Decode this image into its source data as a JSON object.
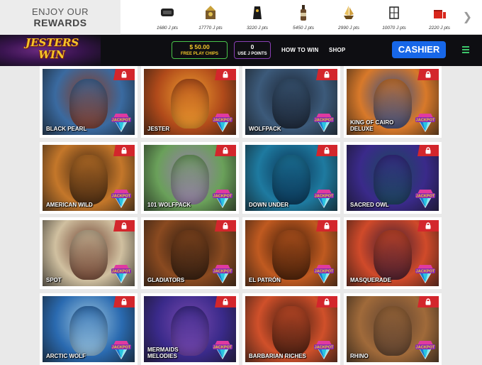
{
  "rewards": {
    "title_line1": "ENJOY OUR",
    "title_line2": "REWARDS",
    "items": [
      {
        "pts": "1680 J pts",
        "icon": "vr-headset-icon"
      },
      {
        "pts": "17770 J pts",
        "icon": "jester-treasure-icon"
      },
      {
        "pts": "3220 J pts",
        "icon": "speaker-icon"
      },
      {
        "pts": "5450 J pts",
        "icon": "bottle-icon"
      },
      {
        "pts": "2990 J pts",
        "icon": "ship-icon"
      },
      {
        "pts": "10070 J pts",
        "icon": "cube-frame-icon"
      },
      {
        "pts": "2220 J pts",
        "icon": "gift-box-icon"
      }
    ]
  },
  "nav": {
    "logo_line1": "JESTERS",
    "logo_line2": "WIN",
    "chips_amount": "$ 50.00",
    "chips_label": "FREE PLAY CHIPS",
    "jpoints_value": "0",
    "jpoints_label": "USE J POINTS",
    "how_to_win": "HOW TO WIN",
    "shop": "SHOP",
    "cashier": "CASHIER"
  },
  "games": [
    {
      "name": "BLACK PEARL",
      "c1": "#3a6aa0",
      "c2": "#8a3a20"
    },
    {
      "name": "JESTER",
      "c1": "#b04a1a",
      "c2": "#f0a030"
    },
    {
      "name": "WOLFPACK",
      "c1": "#3c5a7a",
      "c2": "#1a2230"
    },
    {
      "name": "KING OF CAIRO DELUXE",
      "c1": "#d8792a",
      "c2": "#2a4a8a"
    },
    {
      "name": "AMERICAN WILD",
      "c1": "#c4772a",
      "c2": "#3a2210"
    },
    {
      "name": "101 WOLFPACK",
      "c1": "#6aa05a",
      "c2": "#9a7ab0"
    },
    {
      "name": "DOWN UNDER",
      "c1": "#1e7aa0",
      "c2": "#0a3050"
    },
    {
      "name": "SACRED OWL",
      "c1": "#3a2a8a",
      "c2": "#1a4a5a"
    },
    {
      "name": "SPOT",
      "c1": "#d0c0a0",
      "c2": "#6a3a2a"
    },
    {
      "name": "GLADIATORS",
      "c1": "#8a4a20",
      "c2": "#2a1a10"
    },
    {
      "name": "EL PATRÓN",
      "c1": "#c05a20",
      "c2": "#3a1a08"
    },
    {
      "name": "MASQUERADE",
      "c1": "#d04a2a",
      "c2": "#3a1a30"
    },
    {
      "name": "ARCTIC WOLF",
      "c1": "#2a6ab0",
      "c2": "#a0c8e0"
    },
    {
      "name": "MERMAIDS MELODIES",
      "c1": "#3a2a8a",
      "c2": "#7a4ab0"
    },
    {
      "name": "BARBARIAN RICHES",
      "c1": "#d0502a",
      "c2": "#3a1a10"
    },
    {
      "name": "RHINO",
      "c1": "#a06a3a",
      "c2": "#5a4030"
    }
  ],
  "colors": {
    "cashier": "#1767e8",
    "chips_border": "#49c44a",
    "jpoints_border": "#8a3fb5",
    "lock_badge": "#d3262c",
    "menu": "#3cc56a"
  }
}
